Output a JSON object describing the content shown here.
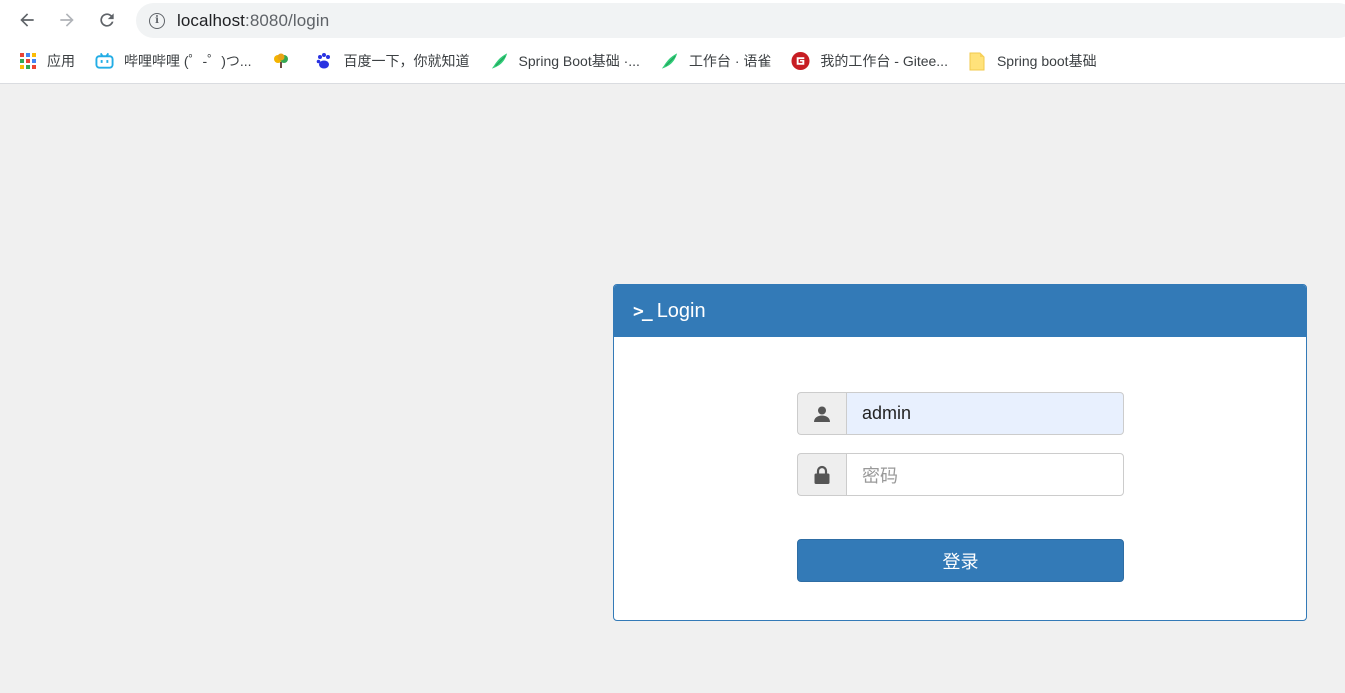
{
  "browser": {
    "url_host": "localhost",
    "url_rest": ":8080/login",
    "bookmarks": [
      {
        "label": "应用",
        "icon": "apps-grid-icon"
      },
      {
        "label": "哔哩哔哩 (゜-゜)つ...",
        "icon": "bilibili-icon"
      },
      {
        "label": "",
        "icon": "tree-icon"
      },
      {
        "label": "百度一下，你就知道",
        "icon": "baidu-paw-icon"
      },
      {
        "label": "Spring Boot基础 ·...",
        "icon": "yuque-bird-icon"
      },
      {
        "label": "工作台 · 语雀",
        "icon": "yuque-bird-icon"
      },
      {
        "label": "我的工作台 - Gitee...",
        "icon": "gitee-icon"
      },
      {
        "label": "Spring boot基础",
        "icon": "folder-note-icon"
      }
    ]
  },
  "login": {
    "title": "Login",
    "icon": "terminal-icon",
    "username_value": "admin",
    "password_placeholder": "密码",
    "submit_label": "登录"
  },
  "colors": {
    "primary": "#337ab7",
    "autofill": "#e8f0fe",
    "page_bg": "#f0f0f0"
  }
}
